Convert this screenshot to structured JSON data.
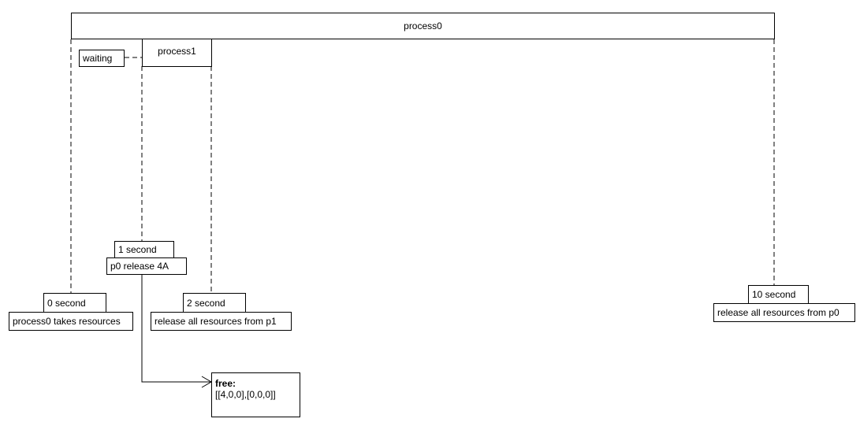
{
  "lifelines": {
    "process0": {
      "label": "process0"
    },
    "process1": {
      "label": "process1"
    }
  },
  "state_waiting": "waiting",
  "events": {
    "t0": {
      "time": "0 second",
      "text": "process0 takes resources"
    },
    "t1": {
      "time": "1 second",
      "text": "p0 release 4A"
    },
    "t2": {
      "time": "2 second",
      "text": "release all resources from p1"
    },
    "t10": {
      "time": "10 second",
      "text": "release all resources from p0"
    }
  },
  "note": {
    "title": "free:",
    "value": "[[4,0,0],[0,0,0]]"
  }
}
